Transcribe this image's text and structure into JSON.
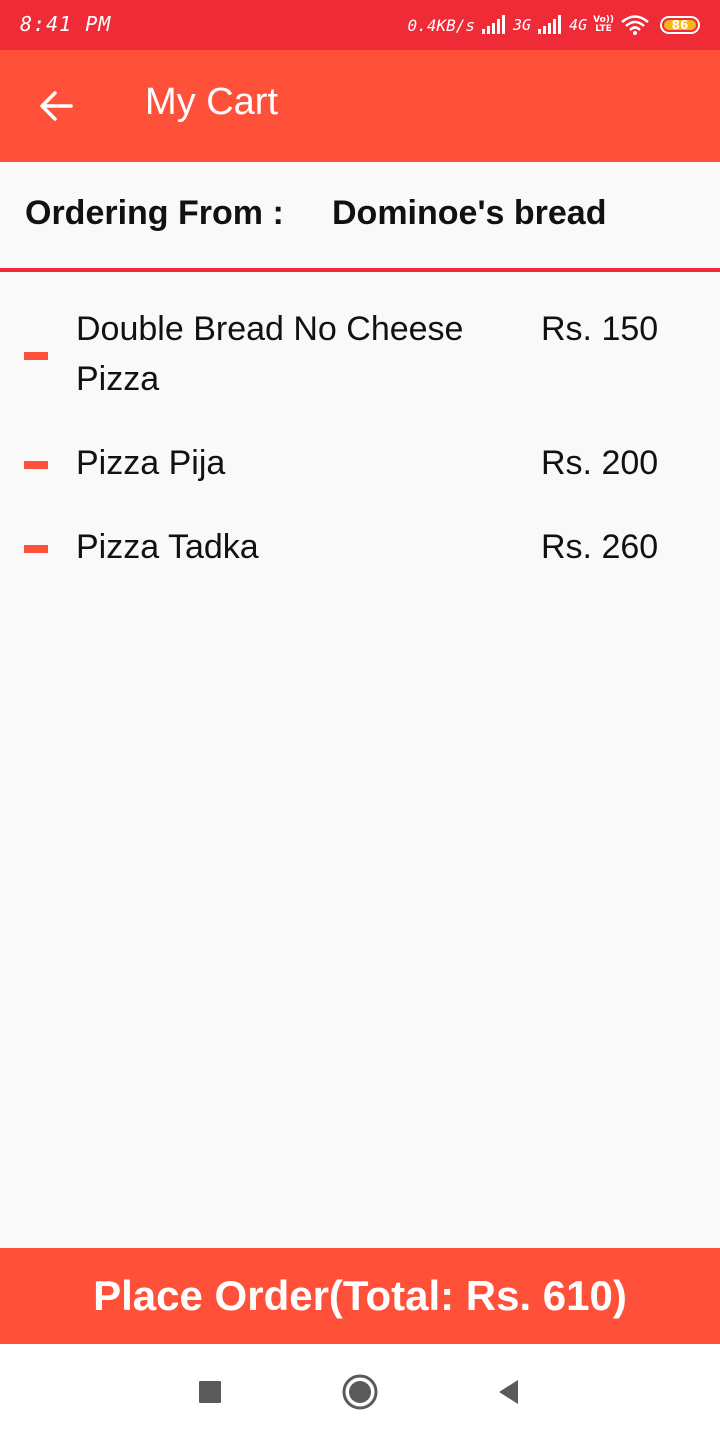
{
  "status_bar": {
    "time": "8:41 PM",
    "net_speed": "0.4KB/s",
    "net_type_1": "3G",
    "net_type_2": "4G",
    "volte_top": "Vo))",
    "volte_bottom": "LTE",
    "battery": "86"
  },
  "app_bar": {
    "back_icon": "arrow-left-icon",
    "title": "My Cart"
  },
  "ordering": {
    "label": "Ordering From :",
    "restaurant": "Dominoe's bread"
  },
  "items": [
    {
      "name": "Double Bread No Cheese Pizza",
      "price": "Rs. 150"
    },
    {
      "name": "Pizza Pija",
      "price": "Rs. 200"
    },
    {
      "name": "Pizza Tadka",
      "price": "Rs. 260"
    }
  ],
  "place_order": {
    "label": "Place Order(Total: Rs. 610)"
  },
  "nav_bar": {
    "recents_icon": "square-icon",
    "home_icon": "circle-icon",
    "back_icon": "triangle-back-icon"
  },
  "colors": {
    "status_bar": "#ee2b37",
    "accent": "#ff513a",
    "divider": "#ee2b37",
    "background": "#f9f9f9"
  }
}
